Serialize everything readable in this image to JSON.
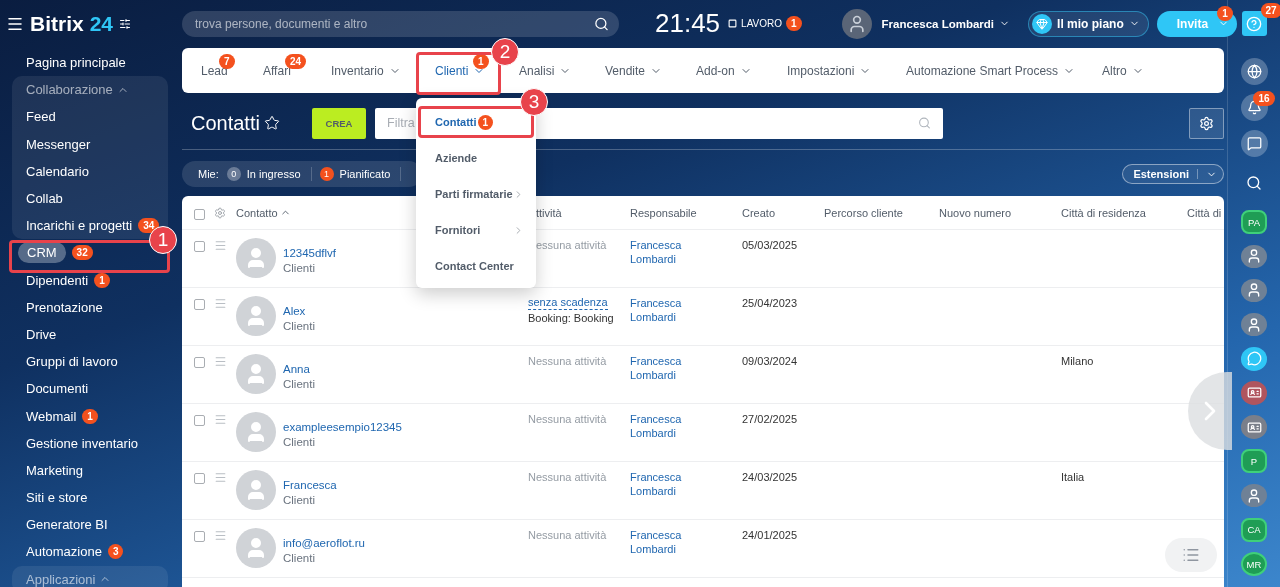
{
  "sidebar": {
    "logo": {
      "name": "Bitrix",
      "suffix": "24"
    },
    "items": [
      {
        "kind": "link",
        "label": "Pagina principale",
        "selected": false
      },
      {
        "kind": "group",
        "label": "Collaborazione",
        "expanded": true,
        "children": [
          {
            "kind": "link",
            "label": "Feed",
            "selected": false
          },
          {
            "kind": "link",
            "label": "Messenger",
            "selected": false
          },
          {
            "kind": "link",
            "label": "Calendario",
            "selected": false
          },
          {
            "kind": "link",
            "label": "Collab",
            "selected": false
          },
          {
            "kind": "link",
            "label": "Incarichi e progetti",
            "badge": "34",
            "selected": false
          }
        ]
      },
      {
        "kind": "link",
        "label": "CRM",
        "badge": "32",
        "selected": true
      },
      {
        "kind": "link",
        "label": "Dipendenti",
        "badge": "1",
        "selected": false
      },
      {
        "kind": "link",
        "label": "Prenotazione",
        "selected": false
      },
      {
        "kind": "link",
        "label": "Drive",
        "selected": false
      },
      {
        "kind": "link",
        "label": "Gruppi di lavoro",
        "selected": false
      },
      {
        "kind": "link",
        "label": "Documenti",
        "selected": false
      },
      {
        "kind": "link",
        "label": "Webmail",
        "badge": "1",
        "selected": false
      },
      {
        "kind": "link",
        "label": "Gestione inventario",
        "selected": false
      },
      {
        "kind": "link",
        "label": "Marketing",
        "selected": false
      },
      {
        "kind": "link",
        "label": "Siti e store",
        "selected": false
      },
      {
        "kind": "link",
        "label": "Generatore BI",
        "selected": false
      },
      {
        "kind": "link",
        "label": "Automazione",
        "badge": "3",
        "selected": false
      },
      {
        "kind": "group",
        "label": "Applicazioni",
        "expanded": true
      }
    ]
  },
  "header": {
    "search": {
      "placeholder": "trova persone, documenti e altro"
    },
    "clock": "21:45",
    "workday": {
      "label": "LAVORO",
      "badge": "1"
    },
    "user": {
      "name": "Francesca Lombardi"
    },
    "plan": {
      "label": "Il mio piano"
    },
    "invite": {
      "label": "Invita",
      "badge": "1"
    }
  },
  "nav": [
    {
      "label": "Lead",
      "badge": "7",
      "menu": false,
      "selected": false
    },
    {
      "label": "Affari",
      "badge": "24",
      "menu": false,
      "selected": false
    },
    {
      "label": "Inventario",
      "menu": true,
      "selected": false
    },
    {
      "label": "Clienti",
      "badge": "1",
      "menu": true,
      "selected": true
    },
    {
      "label": "Analisi",
      "menu": true,
      "selected": false
    },
    {
      "label": "Vendite",
      "menu": true,
      "selected": false
    },
    {
      "label": "Add-on",
      "menu": true,
      "selected": false
    },
    {
      "label": "Impostazioni",
      "menu": true,
      "selected": false
    },
    {
      "label": "Automazione Smart Process",
      "menu": true,
      "selected": false
    },
    {
      "label": "Altro",
      "menu": true,
      "selected": false
    }
  ],
  "dropdown": [
    {
      "label": "Contatti",
      "badge": "1",
      "submenu": false,
      "selected": true
    },
    {
      "label": "Aziende",
      "submenu": false,
      "selected": false
    },
    {
      "label": "Parti firmatarie",
      "submenu": true,
      "selected": false
    },
    {
      "label": "Fornitori",
      "submenu": true,
      "selected": false
    },
    {
      "label": "Contact Center",
      "submenu": false,
      "selected": false
    }
  ],
  "page": {
    "title": "Contatti",
    "create": "CREA",
    "filter": {
      "placeholder": "Filtra"
    },
    "counters_label": "Mie:",
    "counters": [
      {
        "count": "0",
        "label": "In ingresso",
        "active": false
      },
      {
        "count": "1",
        "label": "Pianificato",
        "active": true
      }
    ],
    "extensions": "Estensioni"
  },
  "table": {
    "select_all": false,
    "columns": [
      "Contatto",
      "ttività",
      "Responsabile",
      "Creato",
      "Percorso cliente",
      "Nuovo numero",
      "Città di residenza",
      "Città di"
    ],
    "rows": [
      {
        "name": "12345dflvf",
        "type": "Clienti",
        "activity": "essuna attività",
        "responsible": "Francesca Lombardi",
        "created": "05/03/2025",
        "checked": false
      },
      {
        "name": "Alex",
        "type": "Clienti",
        "deadline": "senza scadenza",
        "activity_detail": "Booking: Booking",
        "responsible": "Francesca Lombardi",
        "created": "25/04/2023",
        "checked": false
      },
      {
        "name": "Anna",
        "type": "Clienti",
        "activity": "Nessuna attività",
        "responsible": "Francesca Lombardi",
        "created": "09/03/2024",
        "city": "Milano",
        "checked": false
      },
      {
        "name": "exampleesempio12345",
        "type": "Clienti",
        "activity": "Nessuna attività",
        "responsible": "Francesca Lombardi",
        "created": "27/02/2025",
        "checked": false
      },
      {
        "name": "Francesca",
        "type": "Clienti",
        "activity": "Nessuna attività",
        "responsible": "Francesca Lombardi",
        "created": "24/03/2025",
        "city": "Italia",
        "checked": false
      },
      {
        "name": "info@aeroflot.ru",
        "type": "Clienti",
        "activity": "Nessuna attività",
        "responsible": "Francesca Lombardi",
        "created": "24/01/2025",
        "checked": false
      }
    ]
  },
  "right_bar": {
    "help_badge": "27",
    "tools": [
      {
        "kind": "activity"
      },
      {
        "kind": "notifications",
        "badge": "16"
      },
      {
        "kind": "chat"
      }
    ],
    "contacts": [
      {
        "kind": "hex",
        "label": "PA"
      },
      {
        "kind": "photo"
      },
      {
        "kind": "photo"
      },
      {
        "kind": "photo"
      },
      {
        "kind": "chat"
      },
      {
        "kind": "card",
        "color": "#b0555e"
      },
      {
        "kind": "card",
        "color": "#7a7f8a"
      },
      {
        "kind": "hex",
        "label": "P"
      },
      {
        "kind": "photo"
      },
      {
        "kind": "hex",
        "label": "CA"
      },
      {
        "kind": "circle",
        "label": "MR"
      }
    ]
  },
  "annotations": [
    {
      "label": "1"
    },
    {
      "label": "2"
    },
    {
      "label": "3"
    }
  ]
}
